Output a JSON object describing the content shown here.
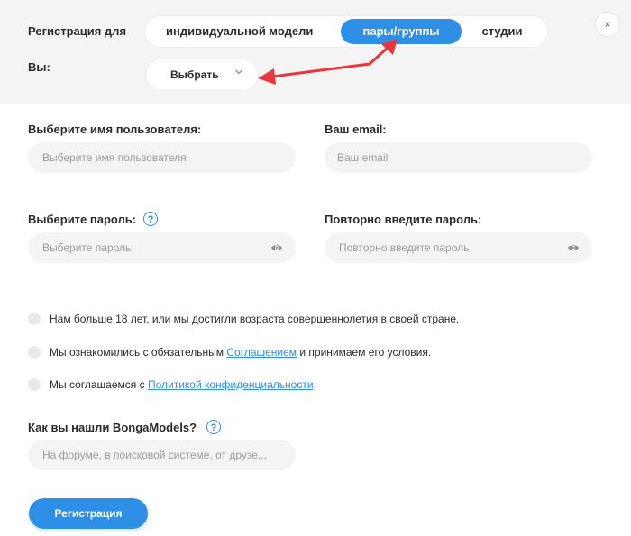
{
  "header": {
    "register_for_label": "Регистрация для",
    "tabs": [
      {
        "label": "индивидуальной модели"
      },
      {
        "label": "пары/группы"
      },
      {
        "label": "студии"
      }
    ],
    "you_label": "Вы:",
    "select_label": "Выбрать",
    "close_symbol": "×"
  },
  "form": {
    "username": {
      "label": "Выберите имя пользователя:",
      "placeholder": "Выберите имя пользователя"
    },
    "email": {
      "label": "Ваш email:",
      "placeholder": "Ваш email"
    },
    "password": {
      "label": "Выберите пароль:",
      "placeholder": "Выберите пароль"
    },
    "password_repeat": {
      "label": "Повторно введите пароль:",
      "placeholder": "Повторно введите пароль"
    },
    "help_symbol": "?",
    "checks": {
      "age": "Нам больше 18 лет, или мы достигли возраста совершеннолетия в своей стране.",
      "agreement_before": "Мы ознакомились с обязательным ",
      "agreement_link": "Соглашением",
      "agreement_after": " и принимаем его условия.",
      "privacy_before": "Мы соглашаемся с ",
      "privacy_link": "Политикой конфиденциальности",
      "privacy_after": "."
    },
    "source": {
      "label": "Как вы нашли BongaModels?",
      "placeholder": "На форуме, в поисковой системе, от друзе..."
    },
    "submit_label": "Регистрация"
  },
  "colors": {
    "accent": "#2d8fe6",
    "annotation_arrow": "#e8373b",
    "field_bg": "#f4f4f4"
  }
}
